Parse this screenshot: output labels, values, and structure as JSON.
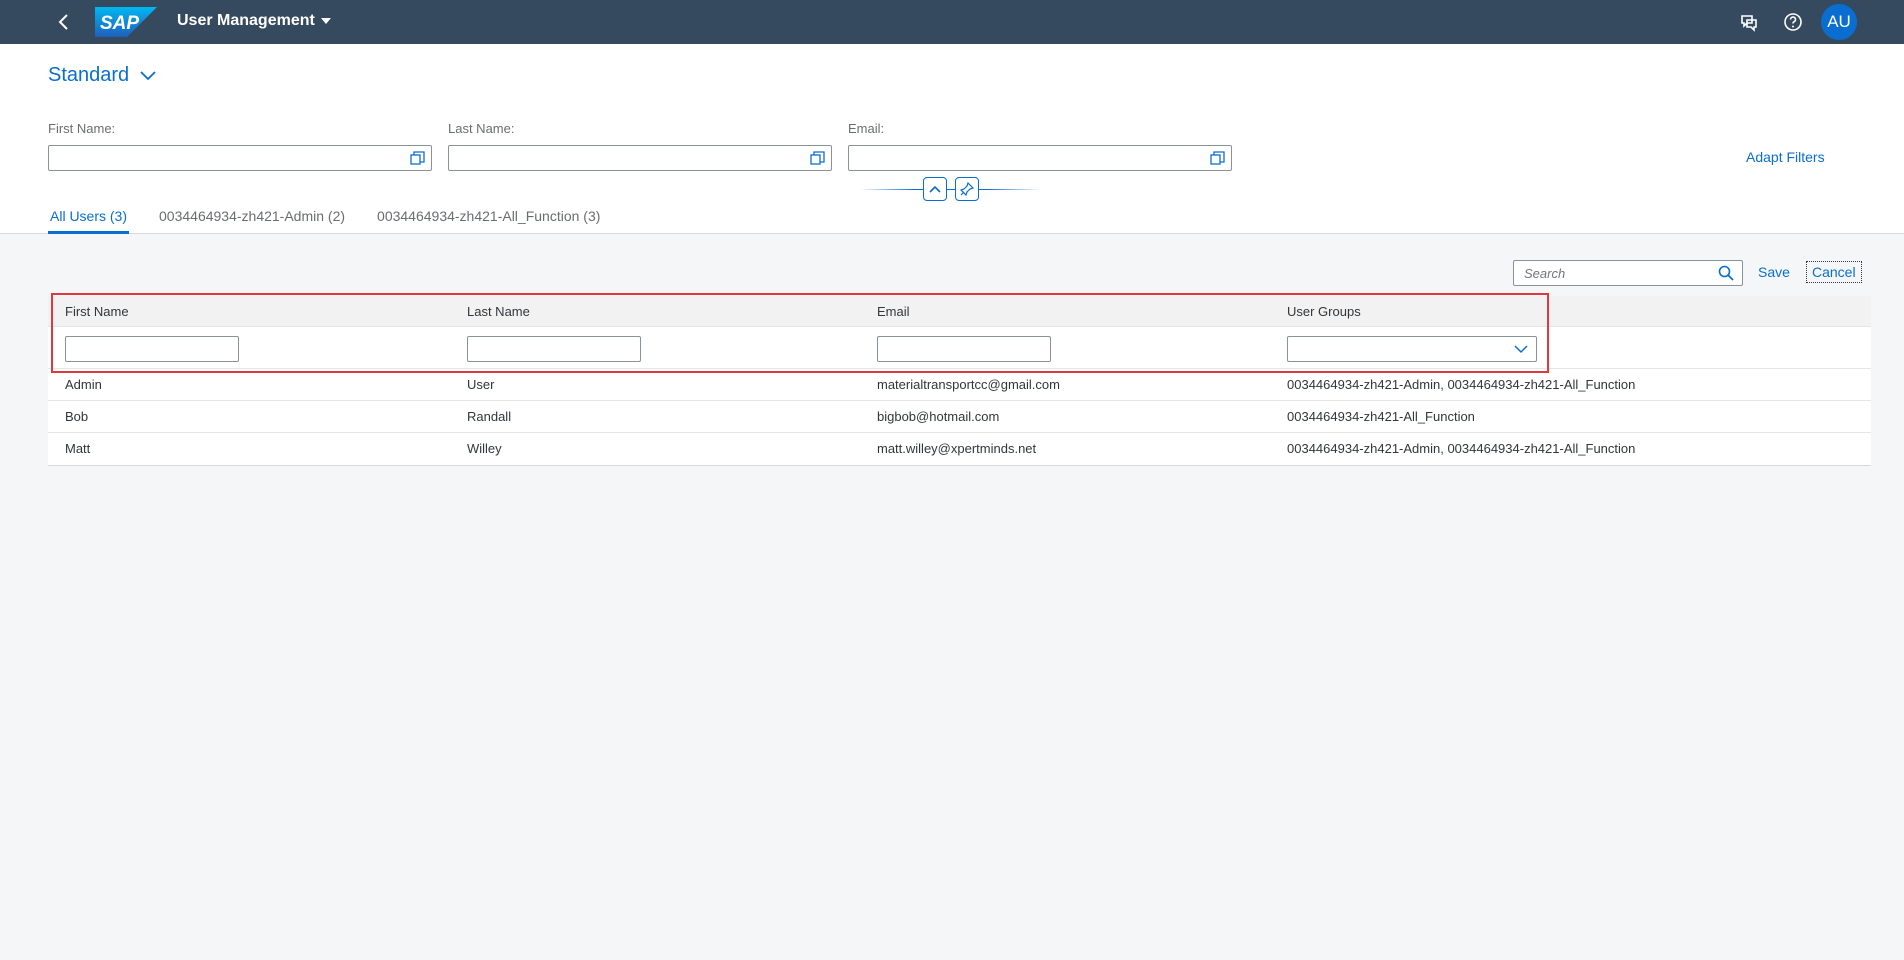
{
  "shell": {
    "title": "User Management",
    "avatar_initials": "AU",
    "logo_text": "SAP",
    "icons": [
      "back-icon",
      "feedback-icon",
      "help-icon"
    ],
    "brand_color": "#354a5f",
    "accent_color": "#0a6ed1"
  },
  "header": {
    "variant": "Standard",
    "filters": [
      {
        "label": "First Name:",
        "value": ""
      },
      {
        "label": "Last Name:",
        "value": ""
      },
      {
        "label": "Email:",
        "value": ""
      }
    ],
    "adapt_filters_label": "Adapt Filters",
    "tabs": [
      {
        "label": "All Users (3)",
        "active": true
      },
      {
        "label": "0034464934-zh421-Admin (2)",
        "active": false
      },
      {
        "label": "0034464934-zh421-All_Function (3)",
        "active": false
      }
    ]
  },
  "toolbar": {
    "search_placeholder": "Search",
    "save_label": "Save",
    "cancel_label": "Cancel"
  },
  "table": {
    "columns": [
      "First Name",
      "Last Name",
      "Email",
      "User Groups"
    ],
    "rows": [
      [
        "Admin",
        "User",
        "materialtransportcc@gmail.com",
        "0034464934-zh421-Admin, 0034464934-zh421-All_Function"
      ],
      [
        "Bob",
        "Randall",
        "bigbob@hotmail.com",
        "0034464934-zh421-All_Function"
      ],
      [
        "Matt",
        "Willey",
        "matt.willey@xpertminds.net",
        "0034464934-zh421-Admin, 0034464934-zh421-All_Function"
      ]
    ],
    "highlight_color": "#e3373e"
  }
}
